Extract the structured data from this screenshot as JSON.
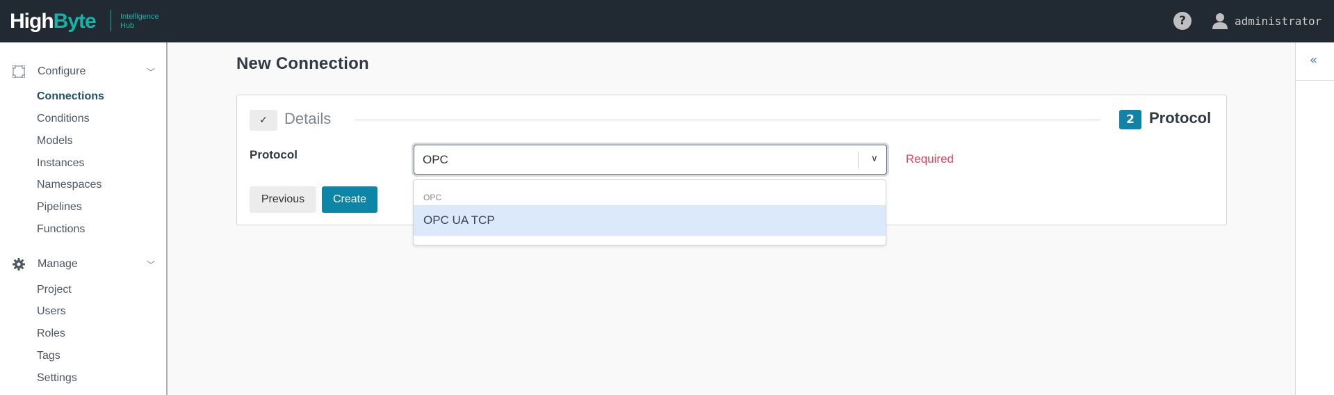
{
  "header": {
    "logo_main_white": "High",
    "logo_main_teal": "Byte",
    "logo_sub_1": "Intelligence",
    "logo_sub_2": "Hub",
    "help_icon": "question-circle-icon",
    "user_icon": "user-icon",
    "username": "administrator"
  },
  "sidebar": {
    "configure": {
      "label": "Configure",
      "icon": "nodes-icon",
      "items": [
        "Connections",
        "Conditions",
        "Models",
        "Instances",
        "Namespaces",
        "Pipelines",
        "Functions"
      ],
      "active": "Connections"
    },
    "manage": {
      "label": "Manage",
      "icon": "gear-icon",
      "items": [
        "Project",
        "Users",
        "Roles",
        "Tags",
        "Settings"
      ]
    }
  },
  "main": {
    "title": "New Connection",
    "steps": [
      {
        "label": "Details",
        "status": "complete"
      },
      {
        "number": "2",
        "label": "Protocol",
        "status": "current"
      }
    ],
    "protocol_label": "Protocol",
    "protocol_value": "OPC",
    "required_text": "Required",
    "dropdown": {
      "group": "OPC",
      "options": [
        "OPC UA TCP"
      ],
      "highlighted": "OPC UA TCP"
    },
    "previous_label": "Previous",
    "create_label": "Create"
  },
  "colors": {
    "accent": "#0c85a6",
    "header_bg": "#212a33",
    "brand_teal": "#17b3a8",
    "error": "#e0435a"
  }
}
